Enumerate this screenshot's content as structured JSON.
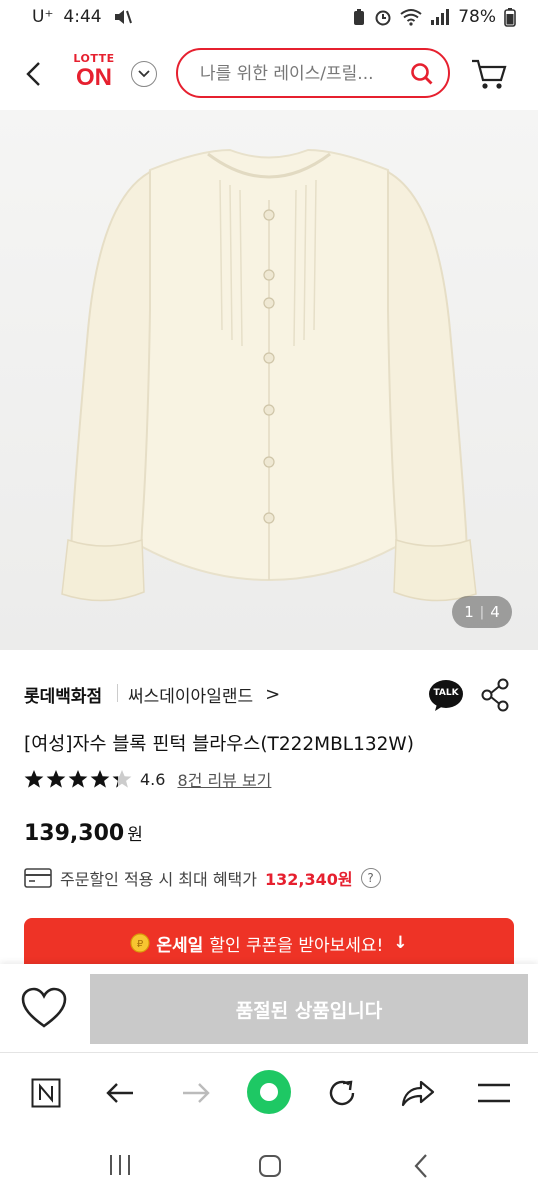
{
  "status_bar": {
    "carrier": "U⁺",
    "time": "4:44",
    "battery": "78%"
  },
  "header": {
    "logo_top": "LOTTE",
    "logo_bottom": "ON",
    "search_placeholder": "나를 위한 레이스/프릴..."
  },
  "gallery": {
    "current": "1",
    "total": "4"
  },
  "product": {
    "brand": "롯데백화점",
    "sub_brand": "써스데이아일랜드",
    "sub_brand_arrow": ">",
    "talk_label": "TALK",
    "title": "[여성]자수 블록 핀턱 블라우스(T222MBL132W)",
    "rating": "4.6",
    "rating_stars": 4.6,
    "review_link": "8건 리뷰 보기",
    "price": "139,300",
    "price_unit": "원",
    "benefit_text": "주문할인 적용 시 최대 혜택가",
    "benefit_price": "132,340원",
    "benefit_help": "?"
  },
  "coupon_banner": {
    "strong": "온세일",
    "text": "할인 쿠폰을 받아보세요!",
    "arrow": "↓"
  },
  "buy_bar": {
    "soldout_label": "품절된 상품입니다"
  },
  "colors": {
    "accent": "#e6202f",
    "coupon": "#ee3326",
    "soldout": "#c9c9c9"
  }
}
